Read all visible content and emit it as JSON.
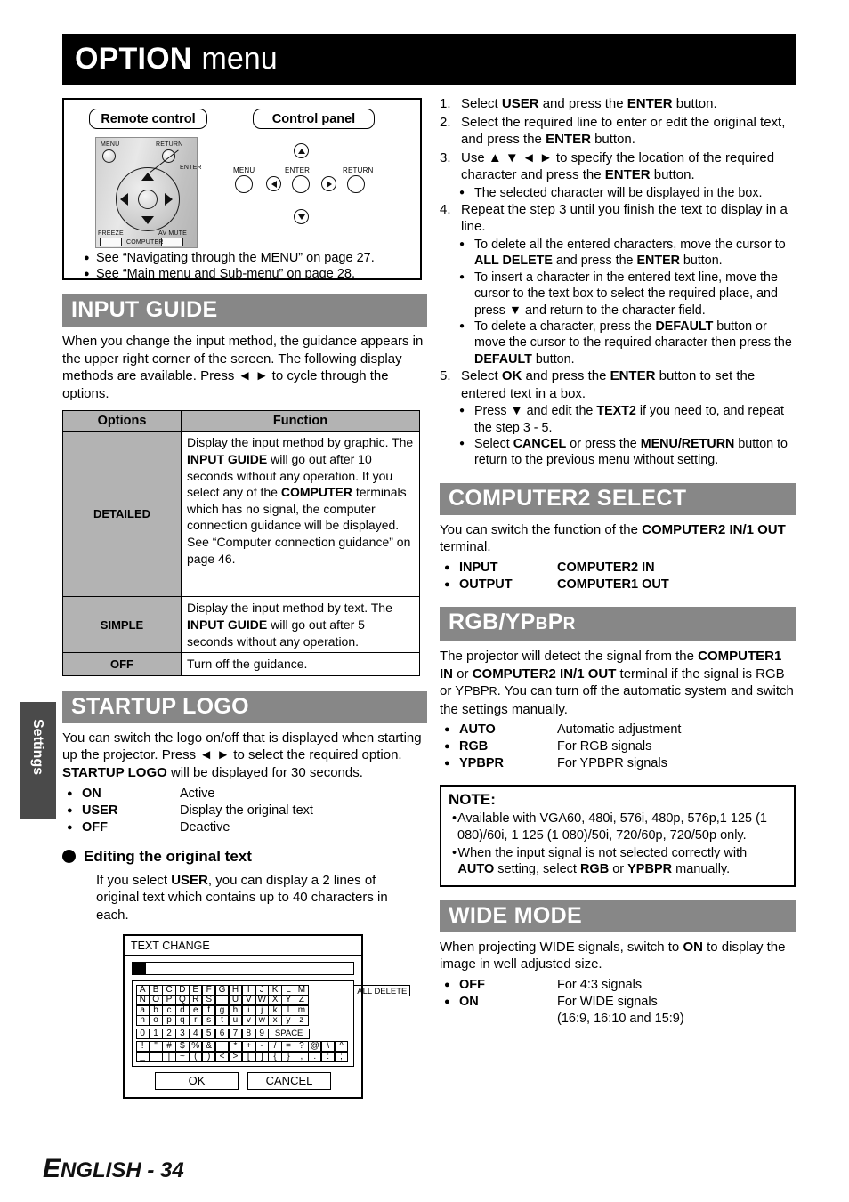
{
  "page": {
    "title_main": "OPTION",
    "title_sub": "menu",
    "side_tab": "Settings",
    "footer_first_letter": "E",
    "footer_rest": "NGLISH - 34"
  },
  "figure": {
    "remote_label": "Remote control",
    "panel_label": "Control panel",
    "remote_buttons": {
      "menu": "MENU",
      "return": "RETURN",
      "enter": "ENTER",
      "freeze": "FREEZE",
      "avmute": "AV MUTE",
      "computer": "COMPUTER"
    },
    "panel_buttons": {
      "menu": "MENU",
      "enter": "ENTER",
      "return": "RETURN"
    },
    "notes": [
      "See “Navigating through the MENU” on page 27.",
      "See “Main menu and Sub-menu” on page 28."
    ],
    "bullet": "●"
  },
  "input_guide": {
    "heading": "INPUT GUIDE",
    "intro_1": "When you change the input method, the guidance appears in the upper right corner of the screen. The following display methods are available. Press ",
    "arrow_left": "◄",
    "arrow_right": "►",
    "intro_2": " to cycle through the options.",
    "table": {
      "col_options": "Options",
      "col_function": "Function",
      "rows": [
        {
          "option": "DETAILED",
          "function_parts": [
            "Display the input method by graphic. The ",
            "INPUT GUIDE",
            " will go out after 10 seconds without any operation. If you select any of the ",
            "COMPUTER",
            " terminals which has no signal, the computer connection guidance will be displayed. See “Computer connection guidance” on page 46."
          ]
        },
        {
          "option": "SIMPLE",
          "function_parts": [
            "Display the input method by text. The ",
            "INPUT GUIDE",
            " will go out after 5 seconds without any operation."
          ]
        },
        {
          "option": "OFF",
          "function_parts": [
            "Turn off the guidance."
          ]
        }
      ]
    }
  },
  "startup_logo": {
    "heading": "STARTUP LOGO",
    "intro_a": "You can switch the logo on/off that is displayed when starting up the projector. Press ",
    "intro_b": " to select the required option. ",
    "intro_bold": "STARTUP LOGO",
    "intro_c": " will be displayed for 30 seconds.",
    "options": [
      {
        "key": "ON",
        "value": "Active"
      },
      {
        "key": "USER",
        "value": "Display the original text"
      },
      {
        "key": "OFF",
        "value": "Deactive"
      }
    ],
    "subheading": "Editing the original text",
    "sub_text_a": "If you select ",
    "sub_text_bold": "USER",
    "sub_text_b": ", you can display a 2 lines of original text which contains up to 40 characters in each."
  },
  "text_change_dialog": {
    "title": "TEXT CHANGE",
    "field_value": "",
    "letter_rows": [
      [
        "A",
        "B",
        "C",
        "D",
        "E",
        "F",
        "G",
        "H",
        "I",
        "J",
        "K",
        "L",
        "M"
      ],
      [
        "N",
        "O",
        "P",
        "Q",
        "R",
        "S",
        "T",
        "U",
        "V",
        "W",
        "X",
        "Y",
        "Z"
      ],
      [
        "a",
        "b",
        "c",
        "d",
        "e",
        "f",
        "g",
        "h",
        "i",
        "j",
        "k",
        "l",
        "m"
      ],
      [
        "n",
        "o",
        "p",
        "q",
        "r",
        "s",
        "t",
        "u",
        "v",
        "w",
        "x",
        "y",
        "z"
      ]
    ],
    "digit_row": [
      "0",
      "1",
      "2",
      "3",
      "4",
      "5",
      "6",
      "7",
      "8",
      "9"
    ],
    "space_label": "SPACE",
    "symbol_rows": [
      [
        "!",
        "\"",
        "#",
        "$",
        "%",
        "&",
        "'",
        "*",
        "+",
        "-",
        "/",
        "=",
        "?",
        "@",
        "\\",
        "^"
      ],
      [
        "_",
        "`",
        "|",
        "~",
        "(",
        ")",
        "<",
        ">",
        "[",
        "]",
        "{",
        "}",
        ",",
        ".",
        ":",
        ";"
      ]
    ],
    "all_delete": "ALL DELETE",
    "ok": "OK",
    "cancel": "CANCEL"
  },
  "steps": [
    {
      "num": "1.",
      "parts": [
        "Select ",
        "USER",
        " and press the ",
        "ENTER",
        " button."
      ],
      "bold_idx": [
        1,
        3
      ],
      "subs": []
    },
    {
      "num": "2.",
      "parts": [
        "Select the required line to enter or edit the original text, and press the ",
        "ENTER",
        " button."
      ],
      "bold_idx": [
        1
      ],
      "subs": []
    },
    {
      "num": "3.",
      "parts": [
        "Use ",
        "▲ ▼ ◄ ►",
        " to specify the location of the required character and press the ",
        "ENTER",
        " button."
      ],
      "bold_idx": [
        3
      ],
      "subs": [
        "The selected character will be displayed in the box."
      ]
    },
    {
      "num": "4.",
      "parts": [
        "Repeat the step 3 until you finish the text to display in a line."
      ],
      "bold_idx": [],
      "subs": []
    },
    {
      "num": "5.",
      "parts": [
        "Select ",
        "OK",
        " and press the ",
        "ENTER",
        " button to set the entered text in a box."
      ],
      "bold_idx": [
        1,
        3
      ],
      "subs": []
    }
  ],
  "step4_subs": [
    "To delete all the entered characters, move the cursor to ALL DELETE and press the ENTER button.",
    "To insert a character in the entered text line, move the cursor to the text box to select the required place, and press ▼ and return to the character field.",
    "To delete a character, press the DEFAULT button or move the cursor to the required character then press the DEFAULT button."
  ],
  "step5_subs": [
    "Press ▼ and edit the TEXT2 if you need to, and repeat the step 3 - 5.",
    "Select CANCEL or press the MENU/RETURN button to return to the previous menu without setting."
  ],
  "computer2_select": {
    "heading": "COMPUTER2 SELECT",
    "intro_a": "You can switch the function of the ",
    "intro_bold": "COMPUTER2 IN/1 OUT",
    "intro_b": " terminal.",
    "options": [
      {
        "key": "INPUT",
        "value": "COMPUTER2 IN"
      },
      {
        "key": "OUTPUT",
        "value": "COMPUTER1 OUT"
      }
    ]
  },
  "rgb_ypbpr": {
    "heading_main": "RGB/YP",
    "heading_sub1": "B",
    "heading_mid": "P",
    "heading_sub2": "R",
    "intro_a": "The projector will detect the signal from the ",
    "intro_b1": "COMPUTER1 IN",
    "intro_b2": " or ",
    "intro_b3": "COMPUTER2 IN/1 OUT",
    "intro_c": " terminal if the signal is RGB or YP",
    "intro_sub1": "B",
    "intro_c2": "P",
    "intro_sub2": "R",
    "intro_d": ". You can turn off the automatic system and switch the settings manually.",
    "options": [
      {
        "key": "AUTO",
        "value": "Automatic adjustment"
      },
      {
        "key": "RGB",
        "value": "For RGB signals"
      },
      {
        "key": "YPBPR",
        "value": "For YPBPR signals"
      }
    ]
  },
  "note": {
    "title": "NOTE:",
    "bullet": "•",
    "items": [
      "Available with VGA60, 480i, 576i, 480p, 576p,1 125 (1 080)/60i, 1 125 (1 080)/50i, 720/60p, 720/50p only.",
      "When the input signal is not selected correctly with AUTO setting, select RGB or YPBPR manually."
    ]
  },
  "wide_mode": {
    "heading": "WIDE MODE",
    "intro_a": "When projecting WIDE signals, switch to ",
    "intro_bold": "ON",
    "intro_b": " to display the image in well adjusted size.",
    "options": [
      {
        "key": "OFF",
        "value": "For 4:3 signals",
        "value2": ""
      },
      {
        "key": "ON",
        "value": "For WIDE signals",
        "value2": "(16:9, 16:10 and 15:9)"
      }
    ]
  },
  "colors": {
    "header_gray": "#878787",
    "table_gray": "#b3b3b3",
    "tab_gray": "#4a4a4a",
    "banner_black": "#000000"
  }
}
